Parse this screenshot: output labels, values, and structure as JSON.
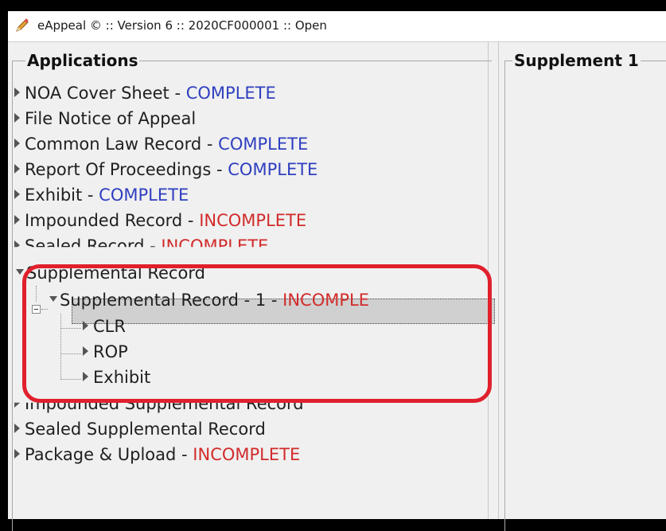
{
  "window": {
    "title": "eAppeal © :: Version 6 :: 2020CF000001 :: Open",
    "icon": "pencil-app-icon"
  },
  "applications": {
    "title": "Applications",
    "items": [
      {
        "label": "NOA Cover Sheet - ",
        "status": "COMPLETE"
      },
      {
        "label": "File Notice of Appeal",
        "status": ""
      },
      {
        "label": "Common Law Record - ",
        "status": "COMPLETE"
      },
      {
        "label": "Report Of Proceedings - ",
        "status": "COMPLETE"
      },
      {
        "label": "Exhibit - ",
        "status": "COMPLETE"
      },
      {
        "label": "Impounded Record - ",
        "status": "INCOMPLETE"
      },
      {
        "label": "Sealed Record - ",
        "status": "INCOMPLETE"
      },
      {
        "label": "Supplemental Record",
        "status": ""
      },
      {
        "label": "Supplemental Record - 1 - ",
        "status": "INCOMPLE"
      },
      {
        "label": "CLR",
        "status": ""
      },
      {
        "label": "ROP",
        "status": ""
      },
      {
        "label": "Exhibit",
        "status": ""
      },
      {
        "label": "Impounded Supplemental Record",
        "status": ""
      },
      {
        "label": "Sealed Supplemental Record",
        "status": ""
      },
      {
        "label": "Package & Upload - ",
        "status": "INCOMPLETE"
      }
    ]
  },
  "detail": {
    "title": "Supplement 1"
  },
  "colors": {
    "complete": "#2f3fbf",
    "incomplete": "#d22b2b",
    "highlight": "#e0202c"
  }
}
